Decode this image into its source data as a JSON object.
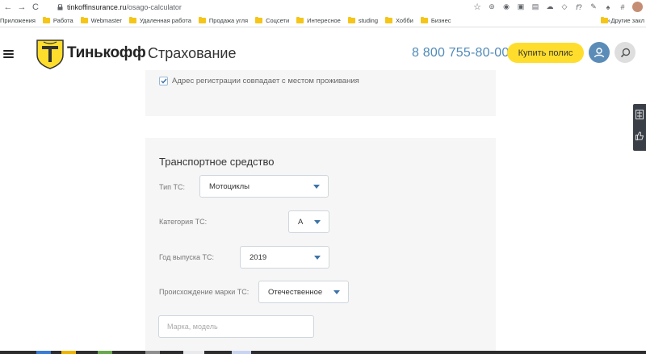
{
  "browser": {
    "url_domain": "tinkoffinsurance.ru",
    "url_path": "/osago-calculator",
    "bookmarks": [
      "Приложения",
      "Работа",
      "Webmaster",
      "Удаленная работа",
      "Продажа угля",
      "Соцсети",
      "Интересное",
      "studing",
      "Хобби",
      "Бизнес"
    ],
    "other_bookmarks": "Другие закл"
  },
  "header": {
    "brand": "Тинькофф",
    "brand_sub": "Страхование",
    "phone": "8 800 755-80-00",
    "buy_button": "Купить полис"
  },
  "address_section": {
    "checkbox_label": "Адрес регистрации совпадает с местом проживания",
    "checked": true
  },
  "vehicle": {
    "title": "Транспортное средство",
    "type_label": "Тип ТС:",
    "type_value": "Мотоциклы",
    "category_label": "Категория ТС:",
    "category_value": "А",
    "year_label": "Год выпуска ТС:",
    "year_value": "2019",
    "origin_label": "Происхождение марки ТС:",
    "origin_value": "Отечественное",
    "model_placeholder": "Марка, модель"
  },
  "colors": {
    "accent_yellow": "#ffdd2d",
    "phone_blue": "#4f8ab8",
    "card_bg": "#f6f6f6",
    "caret_blue": "#3d73a8"
  }
}
